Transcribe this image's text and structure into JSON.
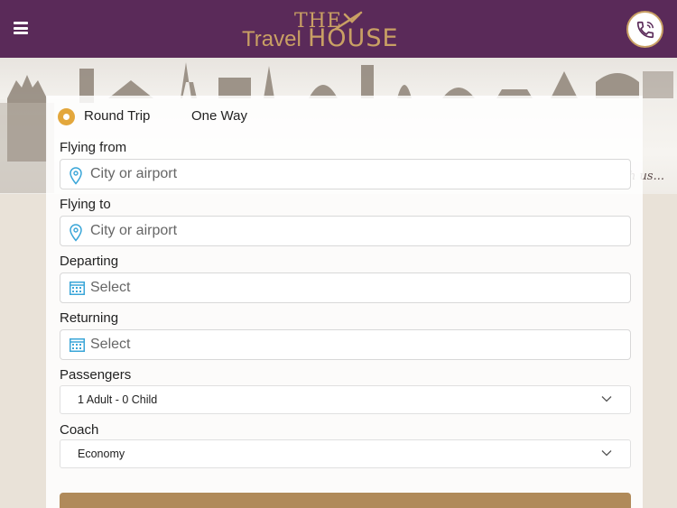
{
  "header": {
    "logo": {
      "line1": "THE",
      "line2_a": "Travel",
      "line2_b": "HOUSE"
    },
    "menu_icon": "hamburger-icon",
    "phone_icon": "phone-icon"
  },
  "banner": {
    "tagline": "with us..."
  },
  "trip_type": {
    "options": [
      "Round Trip",
      "One Way"
    ],
    "selected": "Round Trip"
  },
  "form": {
    "from": {
      "label": "Flying from",
      "placeholder": "City or airport"
    },
    "to": {
      "label": "Flying to",
      "placeholder": "City or airport"
    },
    "departing": {
      "label": "Departing",
      "placeholder": "Select"
    },
    "returning": {
      "label": "Returning",
      "placeholder": "Select"
    },
    "passengers": {
      "label": "Passengers",
      "value": "1 Adult - 0 Child"
    },
    "coach": {
      "label": "Coach",
      "value": "Economy"
    }
  },
  "colors": {
    "header": "#5a2a59",
    "accent": "#c9a064",
    "radio": "#e3a73c",
    "icon": "#3aa6d8",
    "button": "#b08a5a"
  }
}
